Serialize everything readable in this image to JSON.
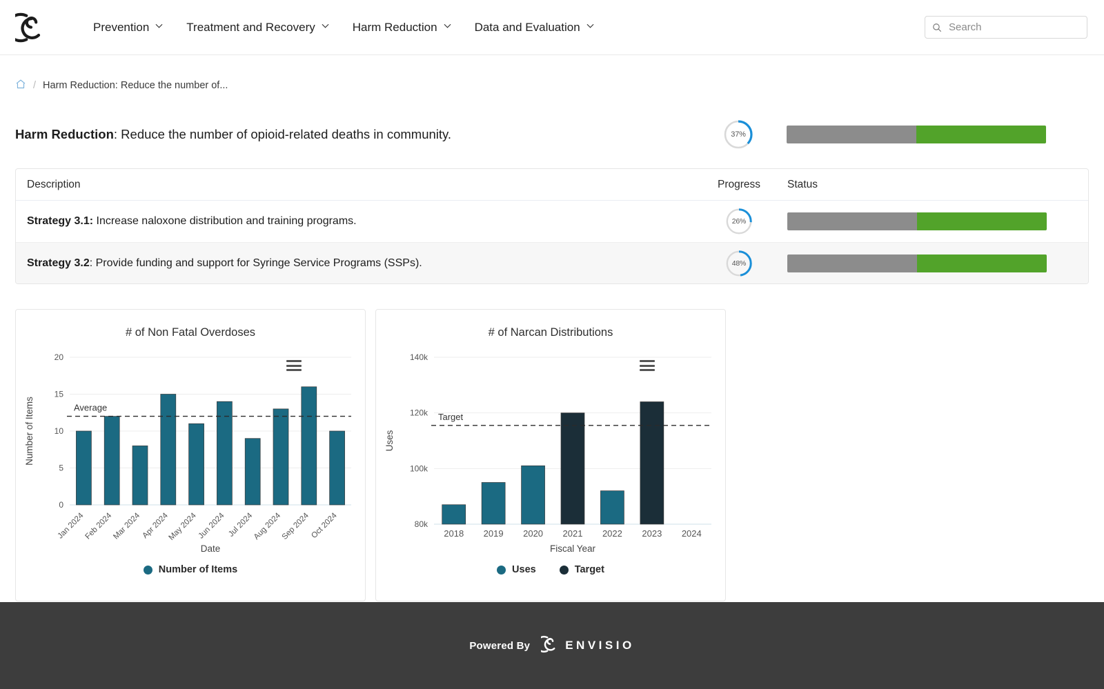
{
  "header": {
    "logo_name": "envisio-logo",
    "nav": [
      {
        "label": "Prevention"
      },
      {
        "label": "Treatment and Recovery"
      },
      {
        "label": "Harm Reduction"
      },
      {
        "label": "Data and Evaluation"
      }
    ],
    "search": {
      "placeholder": "Search",
      "value": "",
      "icon": "search-icon"
    }
  },
  "breadcrumb": {
    "home_icon": "home-icon",
    "separator": "/",
    "current": "Harm Reduction: Reduce the number of..."
  },
  "goal": {
    "label_bold": "Harm Reduction",
    "label_rest": ": Reduce the number of opioid-related deaths in community.",
    "progress_pct": 37,
    "progress_text": "37%",
    "status_gray_pct": 50,
    "status_green_pct": 50
  },
  "table": {
    "columns": [
      "Description",
      "Progress",
      "Status"
    ],
    "rows": [
      {
        "desc_bold": "Strategy 3.1:",
        "desc_rest": " Increase naloxone distribution and training programs.",
        "progress_pct": 26,
        "progress_text": "26%",
        "status_gray_pct": 50,
        "status_green_pct": 50
      },
      {
        "desc_bold": "Strategy 3.2",
        "desc_rest": ": Provide funding and support for Syringe Service Programs (SSPs).",
        "progress_pct": 48,
        "progress_text": "48%",
        "status_gray_pct": 50,
        "status_green_pct": 50
      }
    ]
  },
  "colors": {
    "teal": "#1b6a82",
    "navy": "#1b2e38",
    "green": "#52a32a",
    "gray": "#8c8c8c",
    "blue": "#1a8fd8",
    "ring_track": "#d9d9d9"
  },
  "chart_data": [
    {
      "type": "bar",
      "title": "# of Non Fatal Overdoses",
      "xlabel": "Date",
      "ylabel": "Number of Items",
      "categories": [
        "Jan 2024",
        "Feb 2024",
        "Mar 2024",
        "Apr 2024",
        "May 2024",
        "Jun 2024",
        "Jul 2024",
        "Aug 2024",
        "Sep 2024",
        "Oct 2024"
      ],
      "series": [
        {
          "name": "Number of Items",
          "color": "#1b6a82",
          "values": [
            10,
            12,
            8,
            15,
            11,
            14,
            9,
            13,
            16,
            10
          ]
        }
      ],
      "ylim": [
        0,
        20
      ],
      "yticks": [
        0,
        5,
        10,
        15,
        20
      ],
      "ytick_labels": [
        "0",
        "5",
        "10",
        "15",
        "20"
      ],
      "grid": true,
      "legend_position": "bottom",
      "legend": [
        {
          "label": "Number of Items",
          "color": "#1b6a82"
        }
      ],
      "annotation": {
        "label": "Average",
        "value": 12,
        "style": "dashed"
      },
      "menu_icon": "hamburger-menu-icon"
    },
    {
      "type": "bar",
      "title": "# of Narcan Distributions",
      "xlabel": "Fiscal Year",
      "ylabel": "Uses",
      "categories": [
        "2018",
        "2019",
        "2020",
        "2021",
        "2022",
        "2023",
        "2024"
      ],
      "series": [
        {
          "name": "Uses",
          "color": "#1b6a82",
          "values": [
            87000,
            95000,
            101000,
            null,
            92000,
            null,
            null
          ]
        },
        {
          "name": "Target",
          "color": "#1b2e38",
          "values": [
            null,
            null,
            null,
            120000,
            null,
            124000,
            null
          ]
        }
      ],
      "ylim": [
        80000,
        140000
      ],
      "yticks": [
        80000,
        100000,
        120000,
        140000
      ],
      "ytick_labels": [
        "80k",
        "100k",
        "120k",
        "140k"
      ],
      "grid": true,
      "legend_position": "bottom",
      "legend": [
        {
          "label": "Uses",
          "color": "#1b6a82"
        },
        {
          "label": "Target",
          "color": "#1b2e38"
        }
      ],
      "annotation": {
        "label": "Target",
        "value": 115500,
        "style": "dashed"
      },
      "menu_icon": "hamburger-menu-icon"
    }
  ],
  "footer": {
    "powered_by": "Powered By",
    "brand": "ENVISIO",
    "logo_name": "envisio-logo"
  }
}
